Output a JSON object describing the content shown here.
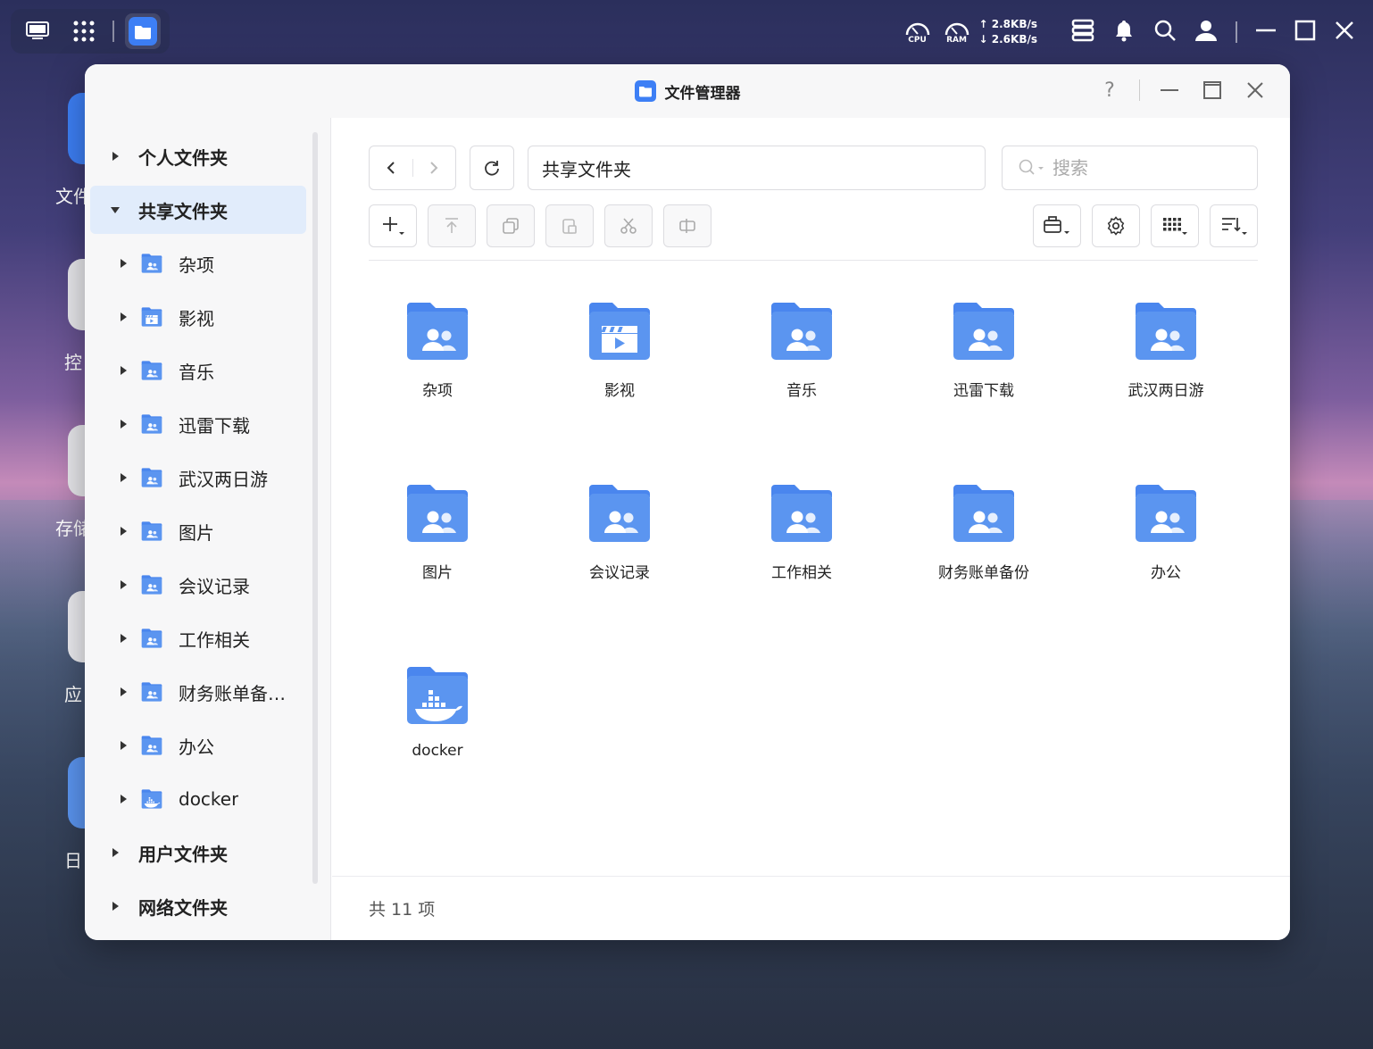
{
  "desktop": {
    "icon_labels": [
      "文件",
      "控",
      "存储",
      "应",
      "日"
    ]
  },
  "taskbar": {
    "cpu_label": "CPU",
    "ram_label": "RAM",
    "upload": "↑ 2.8KB/s",
    "download": "↓ 2.6KB/s"
  },
  "window": {
    "title": "文件管理器",
    "help": "?"
  },
  "sidebar": {
    "roots": [
      {
        "label": "个人文件夹",
        "expanded": false
      },
      {
        "label": "共享文件夹",
        "expanded": true
      },
      {
        "label": "用户文件夹",
        "expanded": false
      },
      {
        "label": "网络文件夹",
        "expanded": false
      }
    ],
    "children": [
      {
        "label": "杂项",
        "icon": "shared-folder-icon"
      },
      {
        "label": "影视",
        "icon": "video-folder-icon"
      },
      {
        "label": "音乐",
        "icon": "shared-folder-icon"
      },
      {
        "label": "迅雷下载",
        "icon": "shared-folder-icon"
      },
      {
        "label": "武汉两日游",
        "icon": "shared-folder-icon"
      },
      {
        "label": "图片",
        "icon": "shared-folder-icon"
      },
      {
        "label": "会议记录",
        "icon": "shared-folder-icon"
      },
      {
        "label": "工作相关",
        "icon": "shared-folder-icon"
      },
      {
        "label": "财务账单备…",
        "icon": "shared-folder-icon"
      },
      {
        "label": "办公",
        "icon": "shared-folder-icon"
      },
      {
        "label": "docker",
        "icon": "docker-folder-icon"
      }
    ]
  },
  "main": {
    "path": "共享文件夹",
    "search_placeholder": "搜索",
    "files": [
      {
        "name": "杂项",
        "icon": "shared-folder-icon"
      },
      {
        "name": "影视",
        "icon": "video-folder-icon"
      },
      {
        "name": "音乐",
        "icon": "shared-folder-icon"
      },
      {
        "name": "迅雷下载",
        "icon": "shared-folder-icon"
      },
      {
        "name": "武汉两日游",
        "icon": "shared-folder-icon"
      },
      {
        "name": "图片",
        "icon": "shared-folder-icon"
      },
      {
        "name": "会议记录",
        "icon": "shared-folder-icon"
      },
      {
        "name": "工作相关",
        "icon": "shared-folder-icon"
      },
      {
        "name": "财务账单备份",
        "icon": "shared-folder-icon"
      },
      {
        "name": "办公",
        "icon": "shared-folder-icon"
      },
      {
        "name": "docker",
        "icon": "docker-folder-icon"
      }
    ],
    "footer": "共 11 项"
  },
  "colors": {
    "accent": "#3d7ff5",
    "folder": "#5b95f0",
    "folder_tab": "#4a86ee",
    "selected_bg": "#e1ecfb"
  }
}
